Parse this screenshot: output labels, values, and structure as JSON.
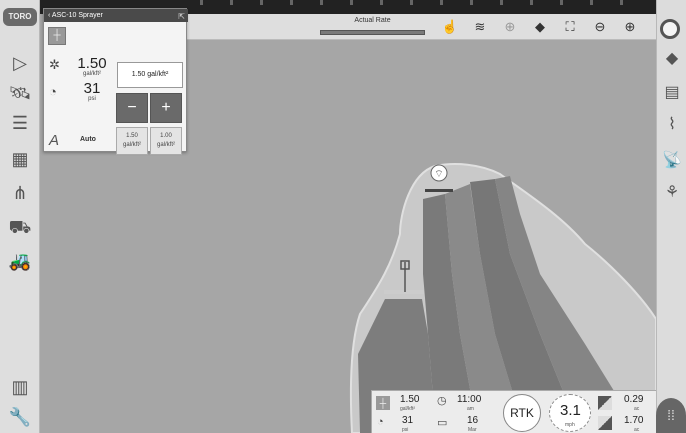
{
  "app": {
    "brand": "TORO",
    "colors": {
      "map_bg": "#a6a6a6",
      "field": "#c9c9c9",
      "coverage": "#7d7d7d",
      "panel_bg": "#f4f4f4",
      "toolbar_bg": "#dedede"
    }
  },
  "sprayer_panel": {
    "title": "ASC-10 Sprayer",
    "rate": {
      "value": "1.50",
      "unit": "gal/kft²"
    },
    "pressure": {
      "value": "31",
      "unit": "psi"
    },
    "target_rate": "1.50 gal/kft²",
    "minus_label": "−",
    "plus_label": "+",
    "auto_label": "Auto",
    "presets": [
      {
        "value": "1.50",
        "unit": "gal/kft²"
      },
      {
        "value": "1.00",
        "unit": "gal/kft²"
      }
    ]
  },
  "top_bar": {
    "actual_rate_label": "Actual Rate",
    "actual_rate_level": 0
  },
  "status_panel": {
    "rate": {
      "value": "1.50",
      "unit": "gal/kft²"
    },
    "pressure": {
      "value": "31",
      "unit": "psi"
    },
    "time": {
      "value": "11:00",
      "unit": "am"
    },
    "date": {
      "value": "16",
      "unit": "Mar"
    },
    "rtk_label": "RTK",
    "speed": {
      "value": "3.1",
      "unit": "mph"
    },
    "area_applied": {
      "value": "0.29",
      "unit": "ac"
    },
    "area_total": {
      "value": "1.70",
      "unit": "ac"
    }
  },
  "left_toolbar": {
    "icons": [
      "guidance-arrow-icon",
      "satellite-icon",
      "layers-list-icon",
      "calculator-icon",
      "boom-sections-icon",
      "sprayer-truck-icon",
      "tractor-icon",
      "files-icon",
      "wrench-icon"
    ]
  },
  "right_toolbar": {
    "icons": [
      "eraser-icon",
      "chart-icon",
      "steering-icon",
      "gps-antenna-icon",
      "implement-icon"
    ]
  },
  "top_tools": {
    "icons": [
      "hand-icon",
      "field-lines-icon",
      "target-icon",
      "layers-icon",
      "fit-view-icon",
      "zoom-out-icon",
      "zoom-in-icon"
    ]
  }
}
